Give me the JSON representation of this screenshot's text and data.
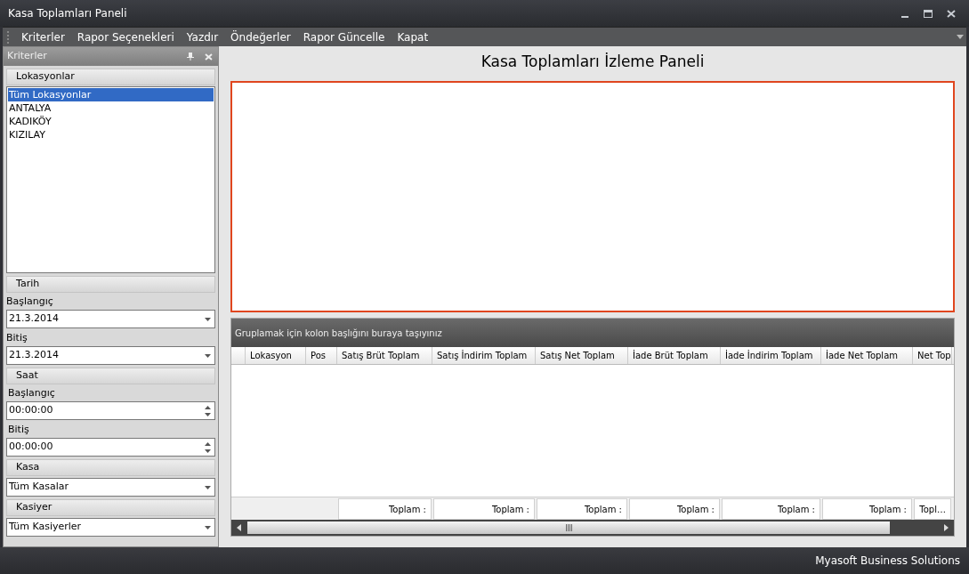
{
  "window": {
    "title": "Kasa Toplamları Paneli"
  },
  "menu": [
    {
      "label": "Kriterler"
    },
    {
      "label": "Rapor Seçenekleri"
    },
    {
      "label": "Yazdır"
    },
    {
      "label": "Öndeğerler"
    },
    {
      "label": "Rapor Güncelle"
    },
    {
      "label": "Kapat"
    }
  ],
  "criteria_panel": {
    "title": "Kriterler",
    "sections": [
      {
        "kind": "list",
        "title": "Lokasyonlar",
        "items": [
          {
            "label": "Tüm Lokasyonlar",
            "selected": true
          },
          {
            "label": "ANTALYA",
            "selected": false
          },
          {
            "label": "KADIKÖY",
            "selected": false
          },
          {
            "label": "KIZILAY",
            "selected": false
          }
        ]
      },
      {
        "kind": "fields",
        "title": "Tarih",
        "fields": [
          {
            "label": "Başlangıç",
            "value": "21.3.2014",
            "kind": "date"
          },
          {
            "label": "Bitiş",
            "value": "21.3.2014",
            "kind": "date"
          }
        ]
      },
      {
        "kind": "fields",
        "title": "Saat",
        "fields": [
          {
            "label": "Başlangıç",
            "value": "00:00:00",
            "kind": "time"
          },
          {
            "label": "Bitiş",
            "value": "00:00:00",
            "kind": "time"
          }
        ]
      },
      {
        "kind": "combo",
        "title": "Kasa",
        "value": "Tüm Kasalar"
      },
      {
        "kind": "combo",
        "title": "Kasiyer",
        "value": "Tüm Kasiyerler"
      }
    ]
  },
  "main": {
    "title": "Kasa Toplamları İzleme Paneli",
    "grid": {
      "group_hint": "Gruplamak için kolon başlığını buraya taşıyınız",
      "columns": [
        "Lokasyon",
        "Pos",
        "Satış Brüt Toplam",
        "Satış İndirim Toplam",
        "Satış Net Toplam",
        "İade Brüt Toplam",
        "İade İndirim Toplam",
        "İade Net Toplam",
        "Net Top"
      ],
      "footer": [
        "Toplam :",
        "Toplam :",
        "Toplam :",
        "Toplam :",
        "Toplam :",
        "Toplam :",
        "Topl…"
      ]
    }
  },
  "status_bar": {
    "text": "Myasoft Business Solutions"
  }
}
